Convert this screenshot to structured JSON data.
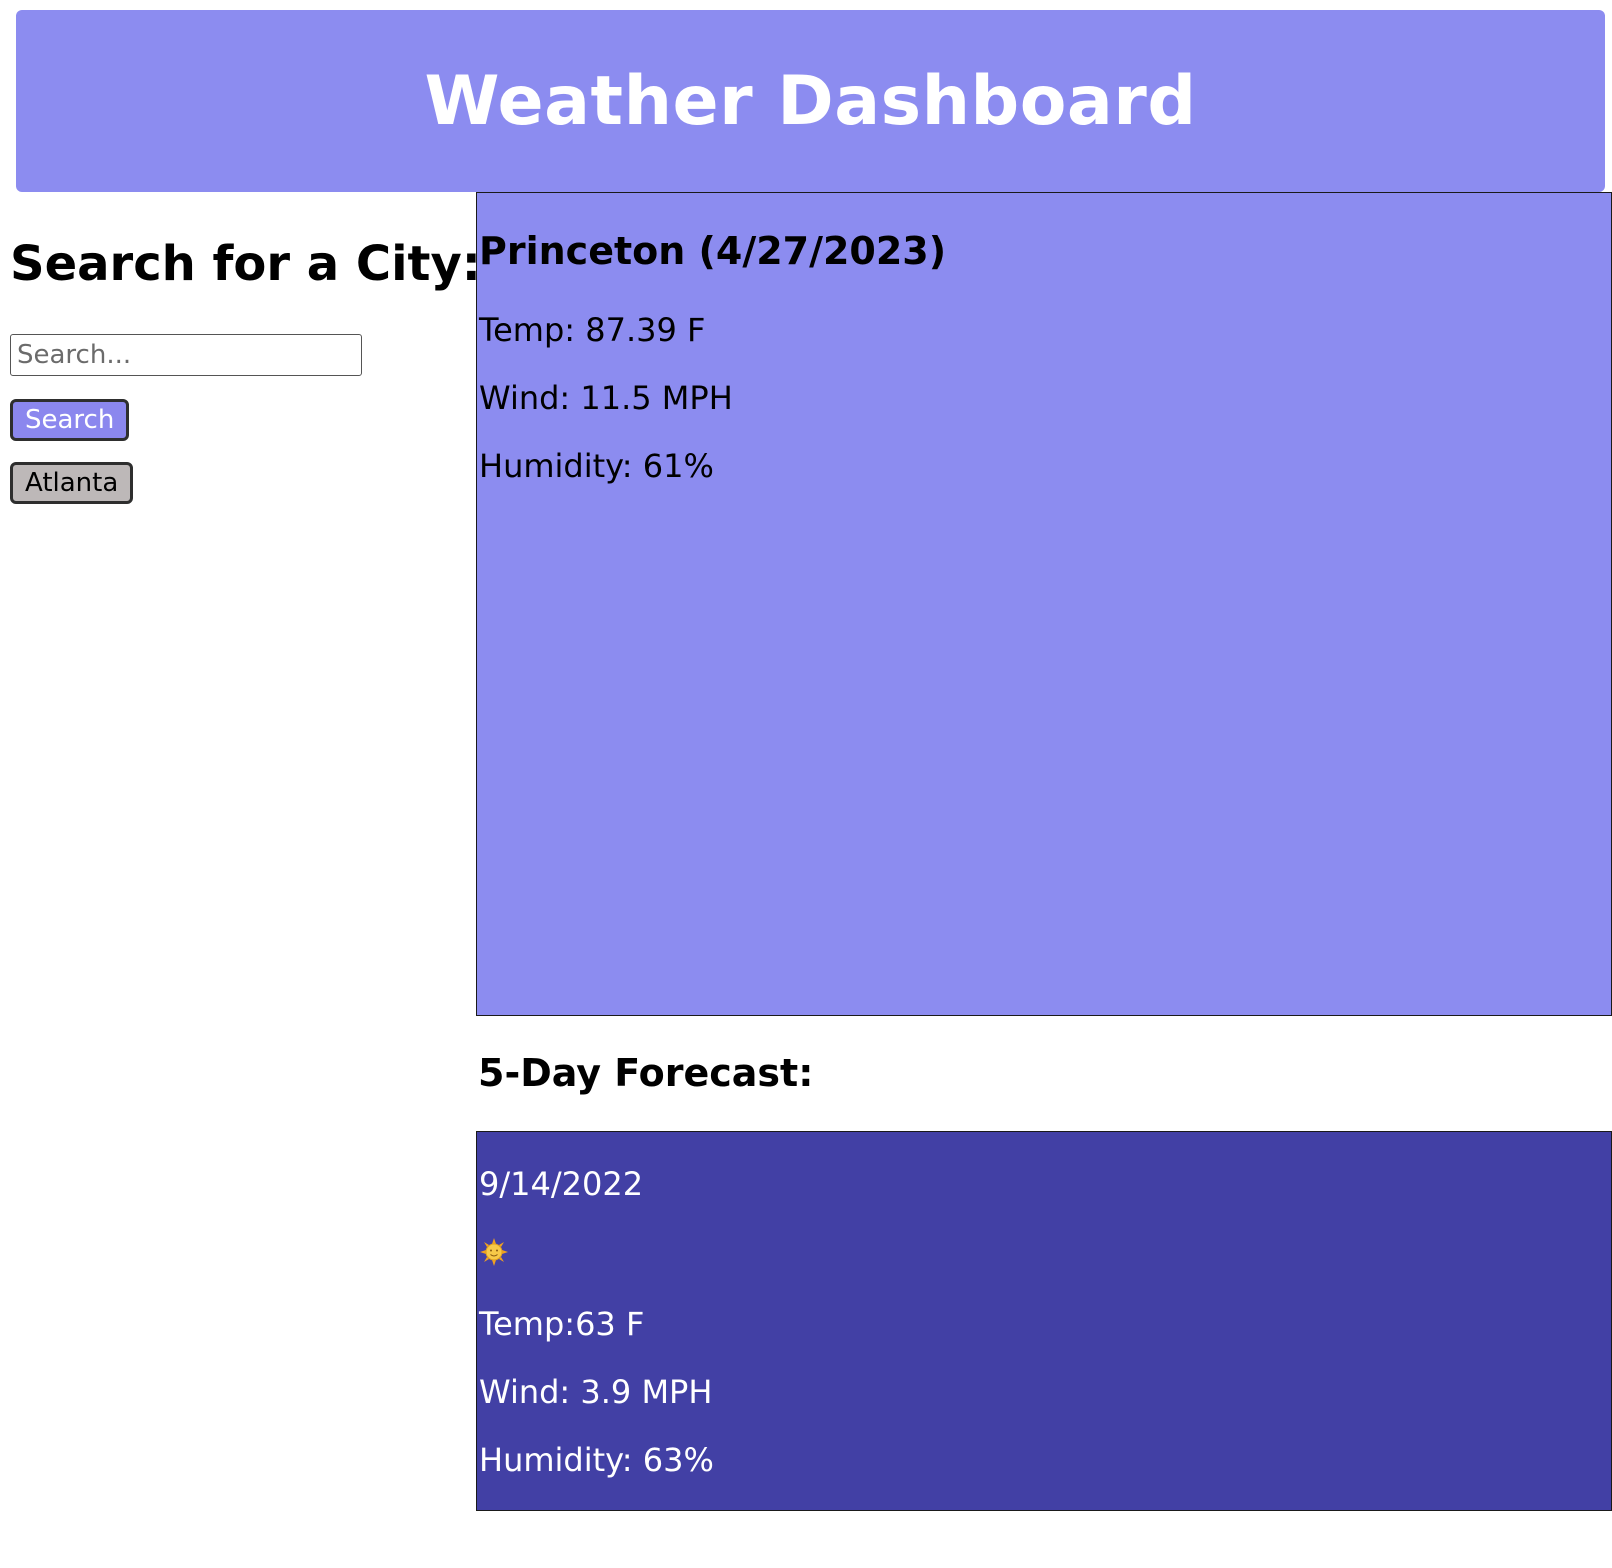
{
  "header": {
    "title": "Weather Dashboard"
  },
  "sidebar": {
    "heading": "Search for a City:",
    "search_placeholder": "Search...",
    "search_value": "",
    "search_button_label": "Search",
    "history": [
      "Atlanta"
    ]
  },
  "current": {
    "city_date": "Princeton (4/27/2023)",
    "temp": "Temp: 87.39 F",
    "wind": "Wind: 11.5 MPH",
    "humidity": "Humidity: 61%"
  },
  "forecast": {
    "title": "5-Day Forecast:",
    "days": [
      {
        "date": "9/14/2022",
        "icon": "sun-icon",
        "temp": "Temp:63 F",
        "wind": "Wind: 3.9 MPH",
        "humidity": "Humidity: 63%"
      }
    ]
  },
  "colors": {
    "accent": "#8c8cf0",
    "forecast_card": "#4240a5",
    "history_button": "#bdb8b8"
  }
}
